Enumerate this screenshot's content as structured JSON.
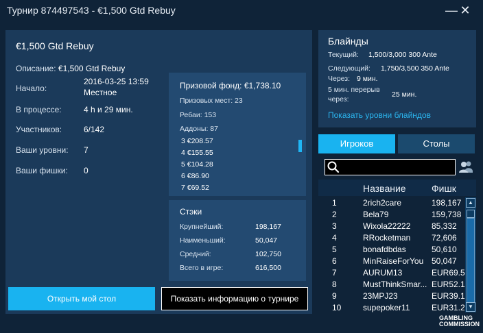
{
  "window": {
    "title": "Турнир 874497543 - €1,500 Gtd Rebuy",
    "minimize": "—",
    "close": "✕"
  },
  "tournament": {
    "name": "€1,500 Gtd Rebuy",
    "description_label": "Описание:",
    "description_value": "€1,500 Gtd Rebuy",
    "start_label": "Начало:",
    "start_value_line1": "2016-03-25 13:59",
    "start_value_line2": "Местное",
    "running_label": "В процессе:",
    "running_value": "4 h и 29 мин.",
    "participants_label": "Участников:",
    "participants_value": "6/142",
    "levels_label": "Ваши уровни:",
    "levels_value": "7",
    "chips_label": "Ваши фишки:",
    "chips_value": "0"
  },
  "prize": {
    "title": "Призовой фонд: €1,738.10",
    "places": "Призовых мест: 23",
    "rebuys": "Ребаи: 153",
    "addons": "Аддоны: 87",
    "payouts": [
      "3 €208.57",
      "4 €155.55",
      "5 €104.28",
      "6 €86.90",
      "7 €69.52"
    ]
  },
  "stacks": {
    "title": "Стэки",
    "largest_label": "Крупнейший:",
    "largest_value": "198,167",
    "smallest_label": "Наименьший:",
    "smallest_value": "50,047",
    "average_label": "Средний:",
    "average_value": "102,750",
    "total_label": "Всего в игре:",
    "total_value": "616,500"
  },
  "buttons": {
    "open_table": "Открыть мой стол",
    "show_info": "Показать информацию о турнире"
  },
  "blinds": {
    "title": "Блайнды",
    "current_label": "Текущий:",
    "current_value": "1,500/3,000 300 Ante",
    "next_label": "Следующий:",
    "next_value": "1,750/3,500 350 Ante",
    "through_label": "Через:",
    "through_value": "9 мин.",
    "break_label_line1": "5 мин. перерыв",
    "break_label_line2": "через:",
    "break_value": "25 мин.",
    "show_levels_link": "Показать уровни блайндов"
  },
  "tabs": {
    "players": "Игроков",
    "tables": "Столы"
  },
  "players_table": {
    "col_name": "Название",
    "col_chips": "Фишк",
    "rows": [
      {
        "rank": "1",
        "name": "2rich2care",
        "chips": "198,167"
      },
      {
        "rank": "2",
        "name": "Bela79",
        "chips": "159,738"
      },
      {
        "rank": "3",
        "name": "Wixola22222",
        "chips": "85,332"
      },
      {
        "rank": "4",
        "name": "RRocketman",
        "chips": "72,606"
      },
      {
        "rank": "5",
        "name": "bonafdbdas",
        "chips": "50,610"
      },
      {
        "rank": "6",
        "name": "MinRaiseForYou",
        "chips": "50,047"
      },
      {
        "rank": "7",
        "name": "AURUM13",
        "chips": "EUR69.5"
      },
      {
        "rank": "8",
        "name": "MustThinkSmar...",
        "chips": "EUR52.1"
      },
      {
        "rank": "9",
        "name": "23MPJ23",
        "chips": "EUR39.1"
      },
      {
        "rank": "10",
        "name": "supepoker11",
        "chips": "EUR31.2"
      }
    ]
  },
  "footer": {
    "logo_line1": "GAMBLING",
    "logo_line2": "COMMISSION"
  },
  "colors": {
    "accent": "#19b3f0",
    "panel": "#1b3a5a",
    "background": "#0f2338",
    "link": "#2bb5ef"
  }
}
